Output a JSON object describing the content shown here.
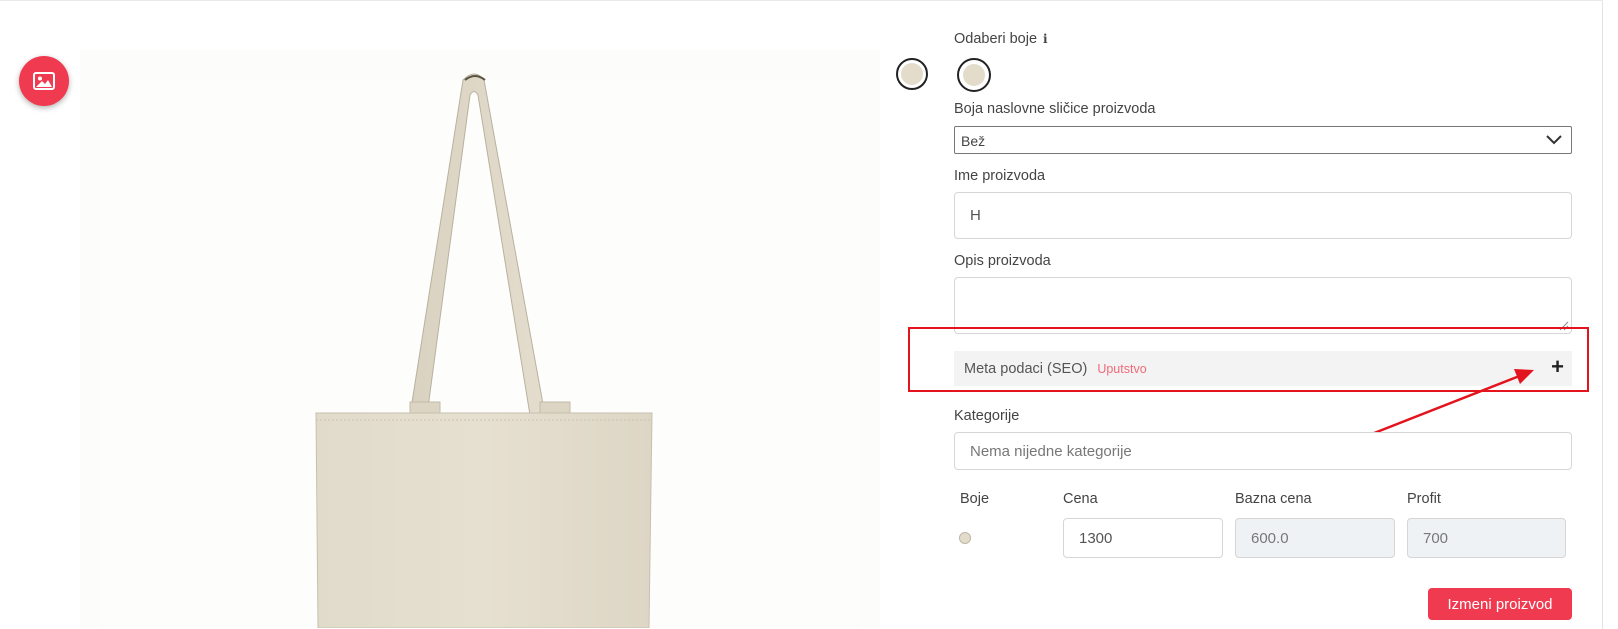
{
  "colors": {
    "accent": "#ef3a50",
    "highlight_red": "#e3141e",
    "bag_beige": "#e3dccb",
    "link_pink": "#f06b7a"
  },
  "toolbar": {
    "image_button_icon": "image-icon"
  },
  "form": {
    "choose_colors_label": "Odaberi boje",
    "info_icon": "i",
    "thumbnail_color_label": "Boja naslovne sličice proizvoda",
    "thumbnail_color_value": "Bež",
    "product_name_label": "Ime proizvoda",
    "product_name_value": "H",
    "description_label": "Opis proizvoda",
    "description_value": "",
    "meta_label": "Meta podaci (SEO)",
    "meta_link": "Uputstvo",
    "meta_expand": "+",
    "categories_label": "Kategorije",
    "categories_placeholder": "Nema nijedne kategorije"
  },
  "pricing": {
    "headers": {
      "colors": "Boje",
      "price": "Cena",
      "base_price": "Bazna cena",
      "profit": "Profit"
    },
    "row": {
      "price": "1300",
      "base_price": "600.0",
      "profit": "700"
    }
  },
  "actions": {
    "submit_label": "Izmeni proizvod"
  }
}
